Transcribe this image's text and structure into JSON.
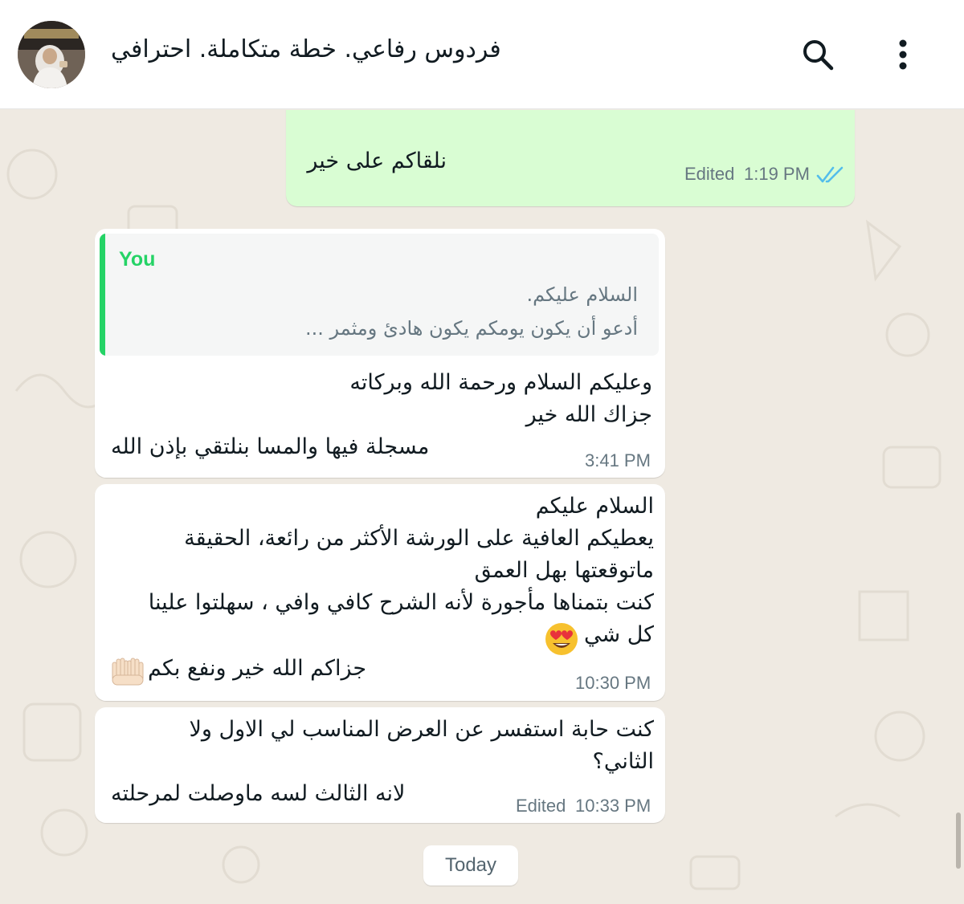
{
  "header": {
    "title": "فردوس رفاعي. خطة متكاملة.  احترافي",
    "search_icon": "search-icon",
    "menu_icon": "more-vertical-icon"
  },
  "messages": {
    "m1": {
      "text": "نلقاكم على خير",
      "edited": "Edited",
      "time": "1:19 PM",
      "status_icon": "double-check-read-icon"
    },
    "m2": {
      "quote_author": "You",
      "quote_line1": "السلام عليكم.",
      "quote_line2": "أدعو أن يكون يومكم يكون هادئ ومثمر ...",
      "line1": "وعليكم السلام ورحمة الله وبركاته",
      "line2": "جزاك الله خير",
      "line3": "مسجلة فيها والمسا بنلتقي بإذن الله",
      "time": "3:41 PM"
    },
    "m3": {
      "line1": "السلام عليكم",
      "line2": "يعطيكم العافية على الورشة الأكثر من رائعة، الحقيقة",
      "line3": "ماتوقعتها بهل العمق",
      "line4": "كنت بتمناها مأجورة لأنه الشرح كافي وافي ، سهلتوا علينا",
      "line5": "كل شي",
      "emoji1": "heart-eyes-emoji",
      "line6": "جزاكم الله خير ونفع بكم",
      "emoji2": "raised-hands-emoji",
      "time": "10:30 PM"
    },
    "m4": {
      "line1": "كنت حابة استفسر عن العرض المناسب لي الاول ولا",
      "line2": "الثاني؟",
      "line3": "لانه الثالث لسه ماوصلت لمرحلته",
      "edited": "Edited",
      "time": "10:33 PM"
    }
  },
  "date_divider": "Today",
  "colors": {
    "outgoing_bubble": "#d9fdd3",
    "incoming_bubble": "#ffffff",
    "chat_background": "#efeae2",
    "accent_green": "#25d366",
    "read_tick_blue": "#53bdeb"
  }
}
